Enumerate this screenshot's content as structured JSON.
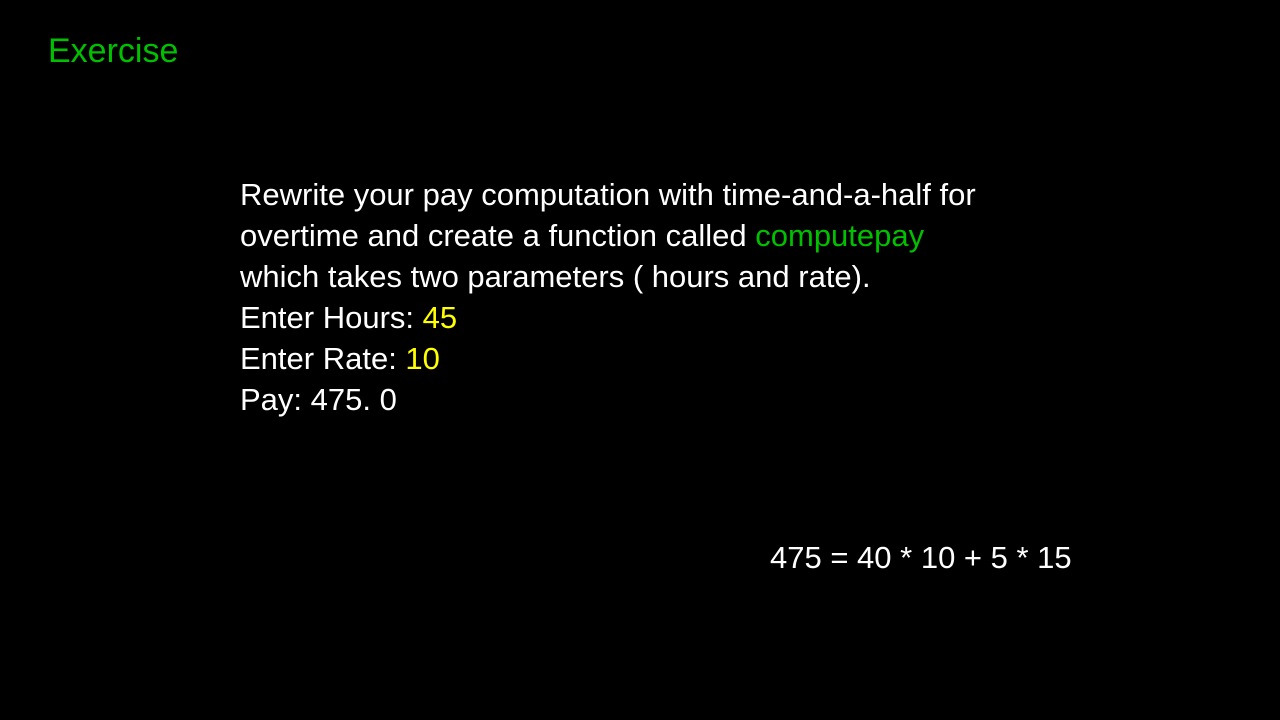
{
  "title": "Exercise",
  "instruction": {
    "part1": "Rewrite your pay computation with time-and-a-half for overtime and create a function called ",
    "func_name": "computepay",
    "part2": " which takes two parameters ( hours and  rate)."
  },
  "example": {
    "hours_label": "Enter Hours: ",
    "hours_value": "45",
    "rate_label": "Enter Rate: ",
    "rate_value": "10",
    "pay_label": "Pay: ",
    "pay_value": "475. 0"
  },
  "calculation": "475 = 40 * 10 + 5 * 15"
}
